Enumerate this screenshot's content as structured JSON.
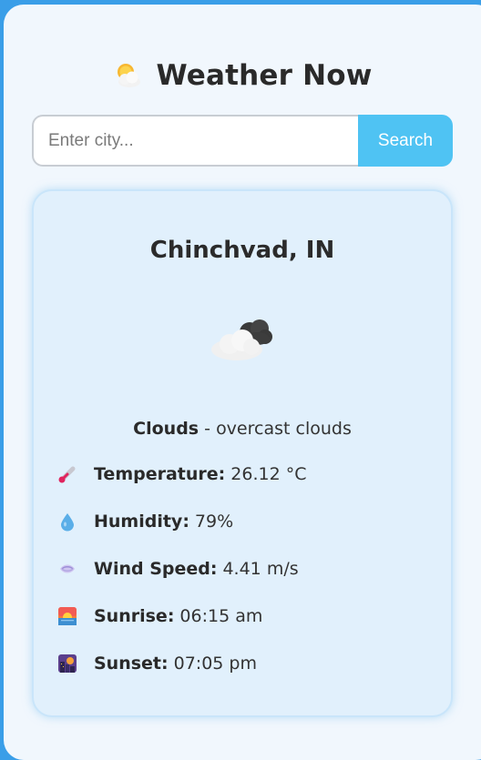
{
  "app": {
    "title": "Weather Now",
    "logo_icon": "sun-behind-cloud-icon"
  },
  "search": {
    "placeholder": "Enter city...",
    "value": "",
    "button_label": "Search"
  },
  "weather": {
    "city": "Chinchvad, IN",
    "condition_icon": "dark-clouds-icon",
    "main": "Clouds",
    "separator": "-",
    "description": "overcast clouds",
    "details": [
      {
        "icon": "thermometer-icon",
        "label": "Temperature:",
        "value": "26.12 °C"
      },
      {
        "icon": "droplet-icon",
        "label": "Humidity:",
        "value": "79%"
      },
      {
        "icon": "wind-icon",
        "label": "Wind Speed:",
        "value": "4.41 m/s"
      },
      {
        "icon": "sunrise-icon",
        "label": "Sunrise:",
        "value": "06:15 am"
      },
      {
        "icon": "sunset-icon",
        "label": "Sunset:",
        "value": "07:05 pm"
      }
    ]
  },
  "colors": {
    "page_background": "#3a9ee8",
    "app_background": "#f1f7fd",
    "card_background": "#e1f0fc",
    "accent": "#4fc3f3"
  }
}
